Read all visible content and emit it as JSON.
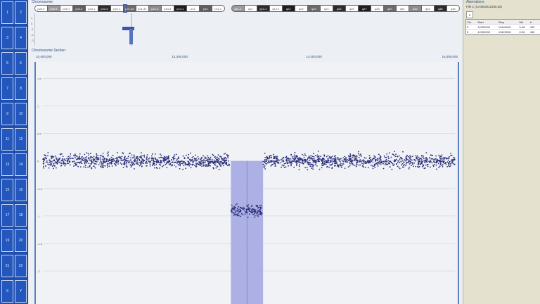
{
  "index_cells": [
    "1",
    "2",
    "3",
    "4",
    "5",
    "6",
    "7",
    "8",
    "9",
    "10",
    "11",
    "12",
    "13",
    "14",
    "15",
    "16",
    "17",
    "18",
    "19",
    "20",
    "21",
    "22",
    "X",
    "Y"
  ],
  "ideogram": {
    "title": "Chromosome",
    "bands": [
      {
        "label": "p26.3",
        "color": "#ffffff"
      },
      {
        "label": "p25.3",
        "color": "#9a9a9a"
      },
      {
        "label": "p25.1",
        "color": "#ffffff"
      },
      {
        "label": "p24.3",
        "color": "#5e5e5e"
      },
      {
        "label": "p24.1",
        "color": "#ffffff"
      },
      {
        "label": "p22.3",
        "color": "#2b2b2b"
      },
      {
        "label": "p22.1",
        "color": "#ffffff"
      },
      {
        "label": "p21.33",
        "color": "#6a6a6a"
      },
      {
        "label": "p21.31",
        "color": "#ffffff"
      },
      {
        "label": "p21.2",
        "color": "#8c8c8c"
      },
      {
        "label": "p14.3",
        "color": "#ffffff"
      },
      {
        "label": "p14.1",
        "color": "#1e1e1e"
      },
      {
        "label": "p13",
        "color": "#ffffff"
      },
      {
        "label": "p12",
        "color": "#5e5e5e"
      },
      {
        "label": "p11.1",
        "color": "#ffffff"
      },
      {
        "label": "q11.2",
        "color": "#9a9a9a"
      },
      {
        "label": "q12",
        "color": "#ffffff"
      },
      {
        "label": "q13.1",
        "color": "#2b2b2b"
      },
      {
        "label": "q13.3",
        "color": "#ffffff"
      },
      {
        "label": "q21",
        "color": "#1e1e1e"
      },
      {
        "label": "q22",
        "color": "#ffffff"
      },
      {
        "label": "q23",
        "color": "#6a6a6a"
      },
      {
        "label": "q24",
        "color": "#ffffff"
      },
      {
        "label": "q25",
        "color": "#2b2b2b"
      },
      {
        "label": "q26",
        "color": "#ffffff"
      },
      {
        "label": "q27",
        "color": "#1e1e1e"
      },
      {
        "label": "q28",
        "color": "#ffffff"
      },
      {
        "label": "q29",
        "color": "#6a6a6a"
      },
      {
        "label": "q31",
        "color": "#ffffff"
      },
      {
        "label": "q32",
        "color": "#8c8c8c"
      },
      {
        "label": "q33",
        "color": "#ffffff"
      },
      {
        "label": "q35",
        "color": "#2b2b2b"
      },
      {
        "label": "q36",
        "color": "#ffffff"
      }
    ],
    "mini_ticks": [
      "1",
      "0",
      "-1",
      "-2",
      "-3"
    ]
  },
  "section": {
    "title": "Chromosome Section",
    "positions": [
      "10,400,000",
      "12,400,000",
      "14,400,000",
      "16,400,000"
    ]
  },
  "colors": {
    "accent": "#1e4fae",
    "dots": "#2a2f7a",
    "region": "#a5a8e3",
    "ideo_mark": "#3a56b0"
  },
  "chart_data": {
    "type": "scatter",
    "xlabel": "",
    "ylabel": "",
    "xlim": [
      10000000,
      16400000
    ],
    "ylim": [
      -2.6,
      1.8
    ],
    "yticks": [
      "1.5",
      "1",
      "0.5",
      "0",
      "-0.5",
      "-1",
      "-1.5",
      "-2"
    ],
    "grid": true,
    "series": [
      {
        "segment": "normal-left",
        "x_range": [
          10000000,
          12900000
        ],
        "y_mean": 0.0,
        "spread": 0.12
      },
      {
        "segment": "deleted",
        "x_range": [
          12920000,
          13400000
        ],
        "y_mean": -0.9,
        "spread": 0.12
      },
      {
        "segment": "normal-right",
        "x_range": [
          13420000,
          16400000
        ],
        "y_mean": 0.0,
        "spread": 0.12
      }
    ],
    "highlight_region": {
      "x_start": 12920000,
      "x_end": 13420000,
      "y_top": 0.0
    }
  },
  "side_panel": {
    "title": "Aberrations",
    "file": "File 1 (CASE0012345.txt)",
    "tab": "1",
    "headers": [
      "Chr",
      "Start",
      "Stop",
      "Mb",
      "#"
    ],
    "rows": [
      [
        "5",
        "12920000",
        "13400000",
        "0.48",
        "420"
      ],
      [
        "5",
        "12920000",
        "13420000",
        "0.50",
        "430"
      ]
    ]
  }
}
